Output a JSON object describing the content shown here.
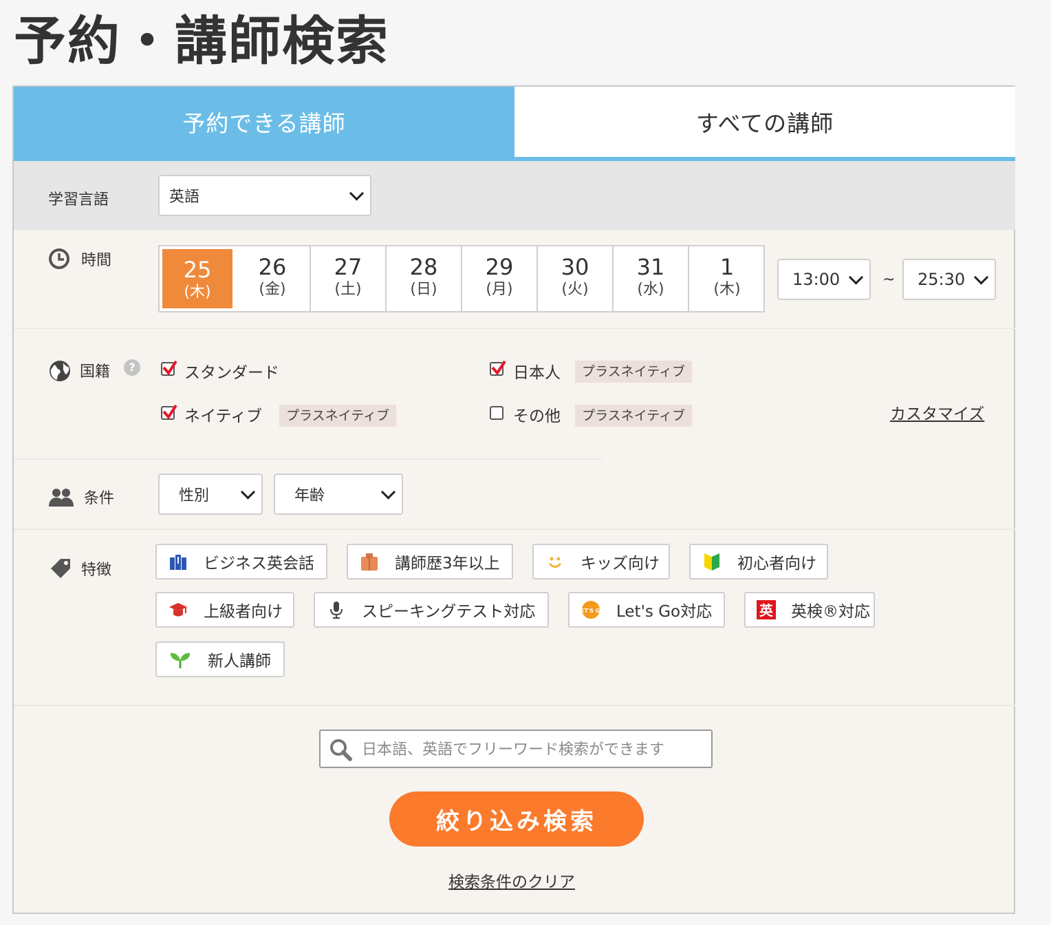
{
  "page": {
    "title": "予約・講師検索"
  },
  "tabs": [
    {
      "label": "予約できる講師",
      "active": true
    },
    {
      "label": "すべての講師",
      "active": false
    }
  ],
  "language": {
    "label": "学習言語",
    "selected": "英語"
  },
  "time": {
    "label": "時間",
    "dates": [
      {
        "day": "25",
        "weekday": "(木)",
        "selected": true
      },
      {
        "day": "26",
        "weekday": "(金)"
      },
      {
        "day": "27",
        "weekday": "(土)"
      },
      {
        "day": "28",
        "weekday": "(日)"
      },
      {
        "day": "29",
        "weekday": "(月)"
      },
      {
        "day": "30",
        "weekday": "(火)"
      },
      {
        "day": "31",
        "weekday": "(水)"
      },
      {
        "day": "1",
        "weekday": "(木)"
      }
    ],
    "from": "13:00",
    "separator": "~",
    "to": "25:30"
  },
  "nationality": {
    "label": "国籍",
    "help": "?",
    "options": [
      {
        "label": "スタンダード",
        "checked": true
      },
      {
        "label": "日本人",
        "checked": true,
        "badge": "プラスネイティブ"
      },
      {
        "label": "ネイティブ",
        "checked": true,
        "badge": "プラスネイティブ"
      },
      {
        "label": "その他",
        "checked": false,
        "badge": "プラスネイティブ"
      }
    ],
    "customize": "カスタマイズ"
  },
  "conditions": {
    "label": "条件",
    "gender": "性別",
    "age": "年齢"
  },
  "features": {
    "label": "特徴",
    "items": [
      {
        "label": "ビジネス英会話",
        "icon": "business-icon"
      },
      {
        "label": "講師歴3年以上",
        "icon": "experience-icon"
      },
      {
        "label": "キッズ向け",
        "icon": "smile-icon"
      },
      {
        "label": "初心者向け",
        "icon": "beginner-mark-icon"
      },
      {
        "label": "上級者向け",
        "icon": "graduation-cap-icon"
      },
      {
        "label": "スピーキングテスト対応",
        "icon": "microphone-icon"
      },
      {
        "label": "Let's Go対応",
        "icon": "lets-go-icon",
        "icon_text": "LET'S GO"
      },
      {
        "label": "英検®対応",
        "icon": "eiken-icon",
        "icon_text": "英"
      },
      {
        "label": "新人講師",
        "icon": "sprout-icon"
      }
    ]
  },
  "search": {
    "placeholder": "日本語、英語でフリーワード検索ができます"
  },
  "submit_label": "絞り込み検索",
  "clear_label": "検索条件のクリア",
  "colors": {
    "tab_blue": "#6bbde8",
    "accent_orange": "#fb7a2b",
    "date_orange": "#f08a3b",
    "check_red": "#e8152c"
  }
}
